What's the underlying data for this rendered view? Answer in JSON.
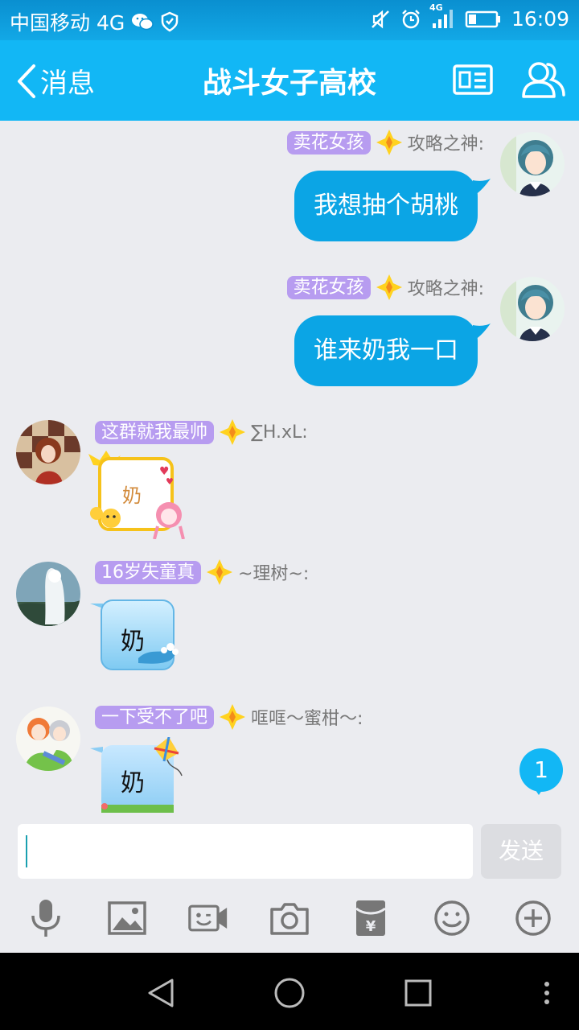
{
  "status_bar": {
    "carrier": "中国移动 4G",
    "network_tag": "4G",
    "time": "16:09",
    "icons": [
      "wechat-icon",
      "shield-icon",
      "mute-icon",
      "alarm-icon",
      "signal-icon",
      "battery-icon"
    ]
  },
  "titlebar": {
    "back_label": "消息",
    "title": "战斗女子高校",
    "icons": [
      "chevron-left-icon",
      "profile-card-icon",
      "group-members-icon"
    ]
  },
  "messages": [
    {
      "side": "right",
      "title": "卖花女孩",
      "nick": "攻略之神:",
      "text": "我想抽个胡桃"
    },
    {
      "side": "right",
      "title": "卖花女孩",
      "nick": "攻略之神:",
      "text": "谁来奶我一口"
    },
    {
      "side": "left",
      "title": "这群就我最帅",
      "nick": "∑H.xL:",
      "sticker_text": "奶"
    },
    {
      "side": "left",
      "title": "16岁失童真",
      "nick": "~理树~:",
      "sticker_text": "奶"
    },
    {
      "side": "left",
      "title": "一下受不了吧",
      "nick": "哐哐～蜜柑～:",
      "sticker_text": "奶"
    }
  ],
  "unread_badge": "1",
  "input": {
    "value": "",
    "send_label": "发送"
  },
  "toolbar": {
    "icons": [
      "microphone-icon",
      "image-icon",
      "video-chat-icon",
      "camera-icon",
      "red-packet-icon",
      "emoji-icon",
      "plus-icon"
    ]
  },
  "navbar": {
    "icons": [
      "back-triangle-icon",
      "home-circle-icon",
      "recents-square-icon",
      "more-dots-icon"
    ]
  },
  "colors": {
    "accent": "#12b7f5",
    "bubble": "#0ba5e5",
    "title_badge": "#b79cf0",
    "background": "#ebecf0"
  }
}
